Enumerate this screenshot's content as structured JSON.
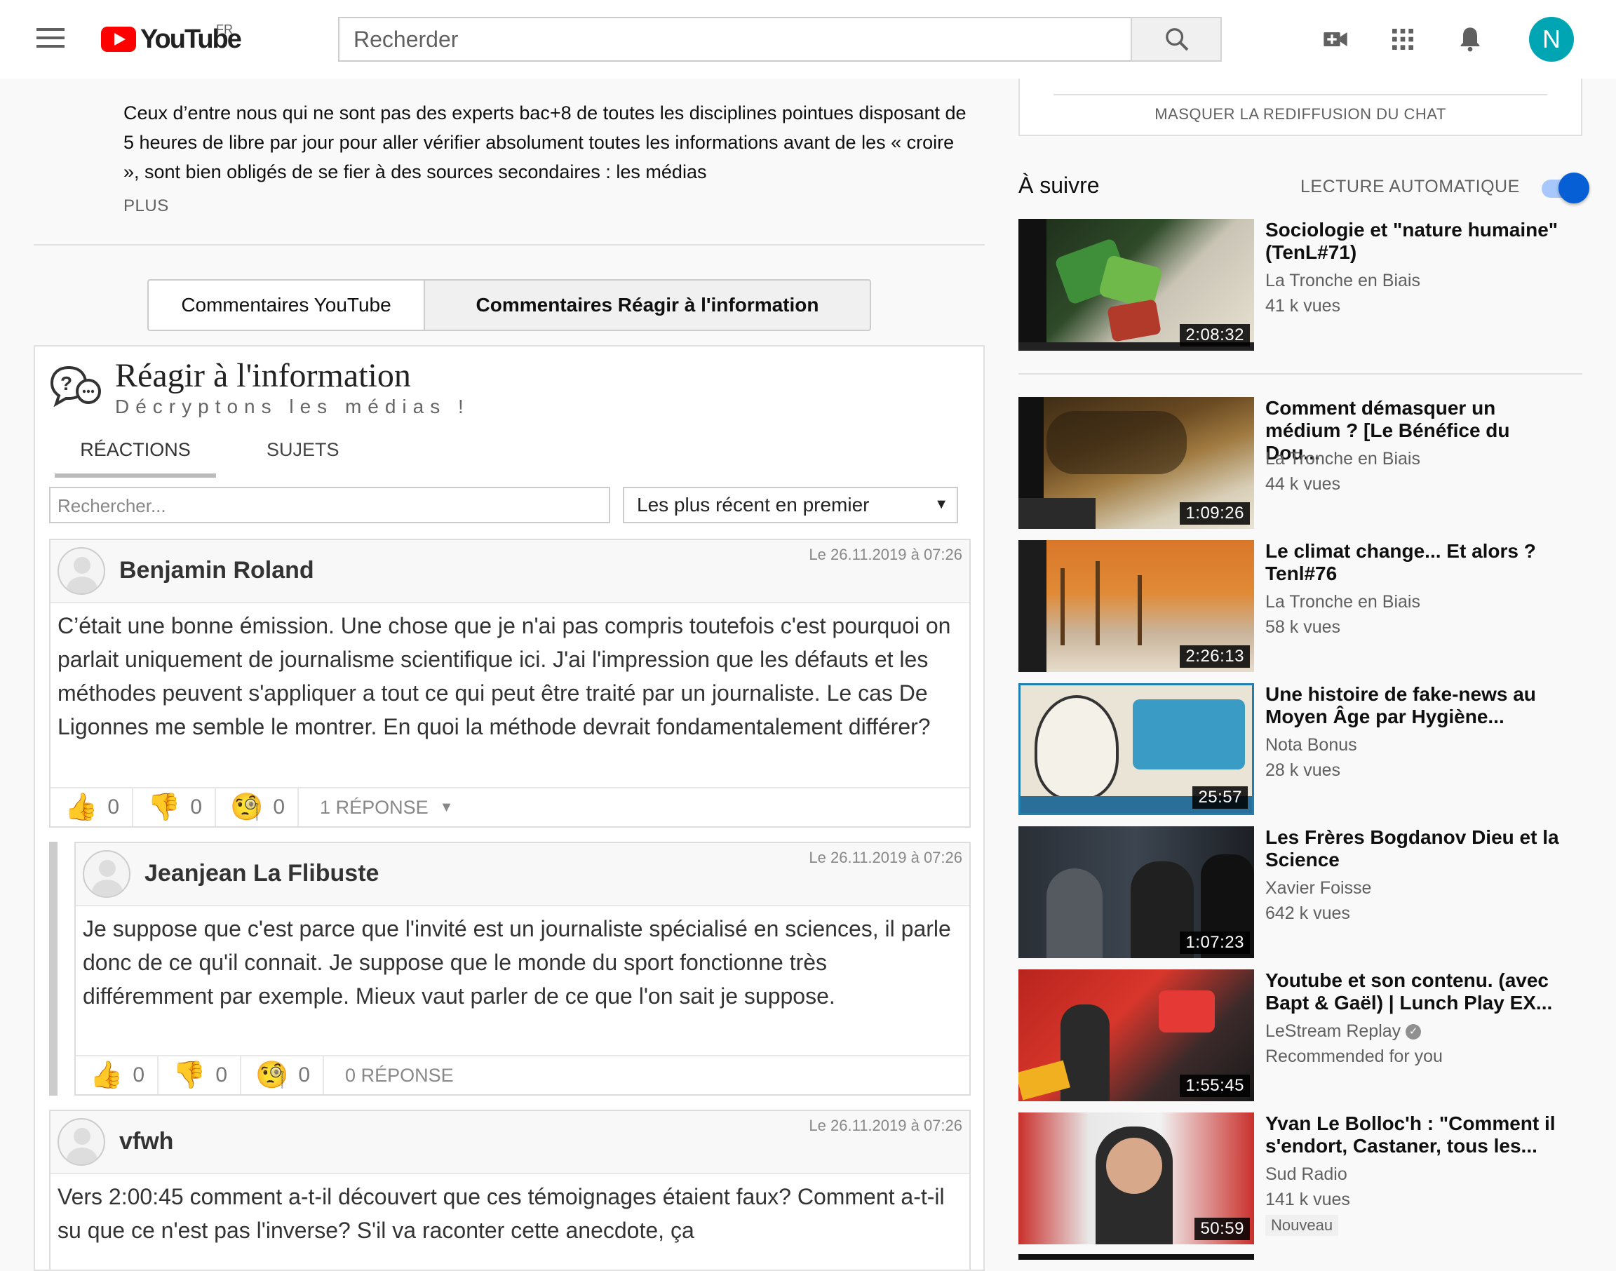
{
  "header": {
    "logo_text": "YouTube",
    "country": "FR",
    "search_placeholder": "Recherder",
    "avatar_letter": "N"
  },
  "description": {
    "text": "Ceux d’entre nous qui ne sont pas des experts bac+8 de toutes les disciplines pointues disposant de 5 heures de libre par jour pour aller vérifier absolument toutes les informations avant de les « croire », sont bien obligés de se fier à des sources secondaires : les médias",
    "more_label": "PLUS"
  },
  "comment_tabs": {
    "youtube": "Commentaires YouTube",
    "reagir": "Commentaires Réagir à l'information"
  },
  "widget": {
    "title": "Réagir à l'information",
    "subtitle": "Décryptons les médias !",
    "tab_reactions": "RÉACTIONS",
    "tab_subjects": "SUJETS",
    "search_placeholder": "Rechercher...",
    "sort_value": "Les plus récent en premier",
    "comments": [
      {
        "name": "Benjamin Roland",
        "date": "Le 26.11.2019 à 07:26",
        "text": "C’était une bonne émission. Une chose que je n'ai pas compris toutefois c'est pourquoi on parlait uniquement de journalisme scientifique ici. J'ai l'impression que les défauts et les méthodes peuvent s'appliquer a tout ce qui peut être traité par un journaliste. Le cas De Ligonnes me semble le montrer. En quoi la méthode devrait fondamentalement différer?",
        "likes": "0",
        "dislikes": "0",
        "wows": "0",
        "replies": "1 RÉPONSE"
      },
      {
        "name": "Jeanjean La Flibuste",
        "date": "Le 26.11.2019 à 07:26",
        "text": "Je suppose que c'est parce que l'invité est un journaliste spécialisé en sciences, il parle donc de ce qu'il connait. Je suppose que le monde du sport fonctionne très différemment par exemple. Mieux vaut parler de ce que l'on sait je suppose.",
        "likes": "0",
        "dislikes": "0",
        "wows": "0",
        "replies": "0 RÉPONSE"
      },
      {
        "name": "vfwh",
        "date": "Le 26.11.2019 à 07:26",
        "text": "Vers 2:00:45 comment a-t-il découvert que ces témoignages étaient faux? Comment a-t-il su que ce n'est pas l'inverse? S'il va raconter cette anecdote, ça"
      }
    ]
  },
  "sidebar": {
    "hide_chat": "MASQUER LA REDIFFUSION DU CHAT",
    "up_next": "À suivre",
    "autoplay": "LECTURE AUTOMATIQUE",
    "videos": [
      {
        "title": "Sociologie et \"nature humaine\" (TenL#71)",
        "channel": "La Tronche en Biais",
        "views": "41 k vues",
        "duration": "2:08:32"
      },
      {
        "title": "Comment démasquer un médium ? [Le Bénéfice du Dou...",
        "channel": "La Tronche en Biais",
        "views": "44 k vues",
        "duration": "1:09:26"
      },
      {
        "title": "Le climat change... Et alors ? Tenl#76",
        "channel": "La Tronche en Biais",
        "views": "58 k vues",
        "duration": "2:26:13"
      },
      {
        "title": "Une histoire de fake-news au Moyen Âge par Hygiène...",
        "channel": "Nota Bonus",
        "views": "28 k vues",
        "duration": "25:57"
      },
      {
        "title": "Les Frères Bogdanov Dieu et la Science",
        "channel": "Xavier Foisse",
        "views": "642 k vues",
        "duration": "1:07:23"
      },
      {
        "title": "Youtube et son contenu. (avec Bapt & Gaël) | Lunch Play EX...",
        "channel": "LeStream Replay",
        "views": "Recommended for you",
        "duration": "1:55:45"
      },
      {
        "title": "Yvan Le Bolloc'h : \"Comment il s'endort, Castaner, tous les...",
        "channel": "Sud Radio",
        "views": "141 k vues",
        "duration": "50:59",
        "badge": "Nouveau"
      }
    ]
  },
  "colors": {
    "accent": "#065fd4",
    "brand_red": "#ff0000",
    "avatar": "#00a5b4"
  }
}
